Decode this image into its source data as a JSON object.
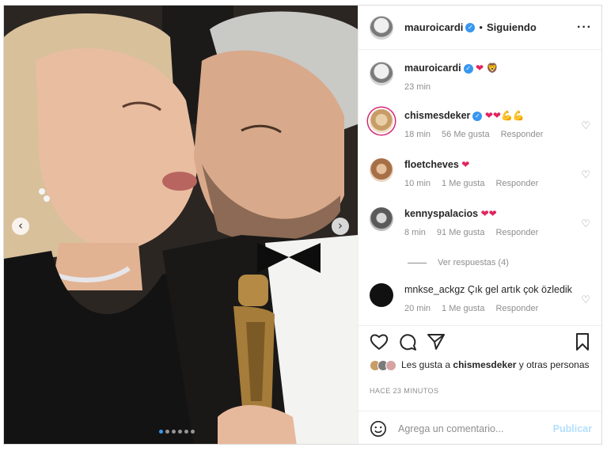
{
  "post": {
    "author": "mauroicardi",
    "follow_label": "Siguiendo",
    "more_icon": "more-options-icon",
    "caption_emojis": "❤ 🦁",
    "caption_time": "23 min"
  },
  "comments": [
    {
      "username": "chismesdeker",
      "verified": true,
      "text": "❤❤💪💪",
      "time": "18 min",
      "likes": "56 Me gusta",
      "reply": "Responder"
    },
    {
      "username": "floetcheves",
      "verified": false,
      "text": "❤",
      "time": "10 min",
      "likes": "1 Me gusta",
      "reply": "Responder"
    },
    {
      "username": "kennyspalacios",
      "verified": false,
      "text": "❤❤",
      "time": "8 min",
      "likes": "91 Me gusta",
      "reply": "Responder"
    },
    {
      "username": "mnkse_ackgz",
      "verified": false,
      "text": "Çık gel artık çok özledik",
      "time": "20 min",
      "likes": "1 Me gusta",
      "reply": "Responder"
    }
  ],
  "view_replies": "Ver respuestas (4)",
  "likes_summary": {
    "prefix": "Les gusta a",
    "user": "chismesdeker",
    "suffix": "y otras personas"
  },
  "timestamp": "HACE 23 MINUTOS",
  "comment_box": {
    "placeholder": "Agrega un comentario...",
    "publish_label": "Publicar"
  },
  "carousel": {
    "total": 6,
    "active_index": 0
  },
  "colors": {
    "verified_blue": "#3897f0",
    "heart_red": "#e0245e",
    "publish_disabled": "#b2dffc"
  }
}
